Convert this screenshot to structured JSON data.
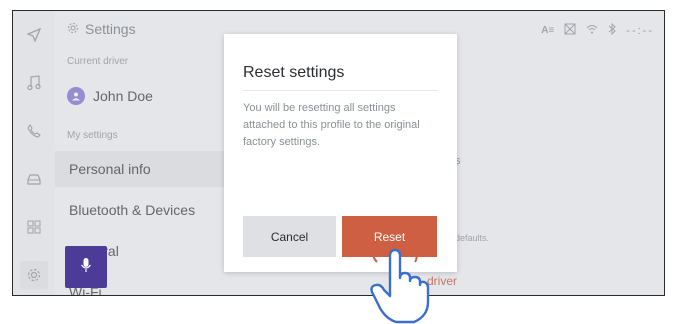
{
  "header": {
    "title": "Settings"
  },
  "sidebar": {
    "current_driver_label": "Current driver",
    "driver_name": "John Doe",
    "my_settings_label": "My settings",
    "items": [
      {
        "label": "Personal info"
      },
      {
        "label": "Bluetooth & Devices"
      },
      {
        "label": "General"
      },
      {
        "label": "Wi-Fi"
      }
    ]
  },
  "right_panel": {
    "hint_text": "defaults.",
    "link_text": "driver",
    "fragment_s": "s"
  },
  "status_bar": {
    "icons": [
      "text-size-icon",
      "no-signal-icon",
      "wifi-icon",
      "bluetooth-icon"
    ],
    "time": "--:--"
  },
  "dialog": {
    "title": "Reset settings",
    "body": "You will be resetting all settings attached to this profile to the original factory settings.",
    "cancel_label": "Cancel",
    "reset_label": "Reset"
  },
  "colors": {
    "accent": "#cf5f43",
    "mic": "#4c3c98",
    "avatar": "#7a6bd1"
  }
}
